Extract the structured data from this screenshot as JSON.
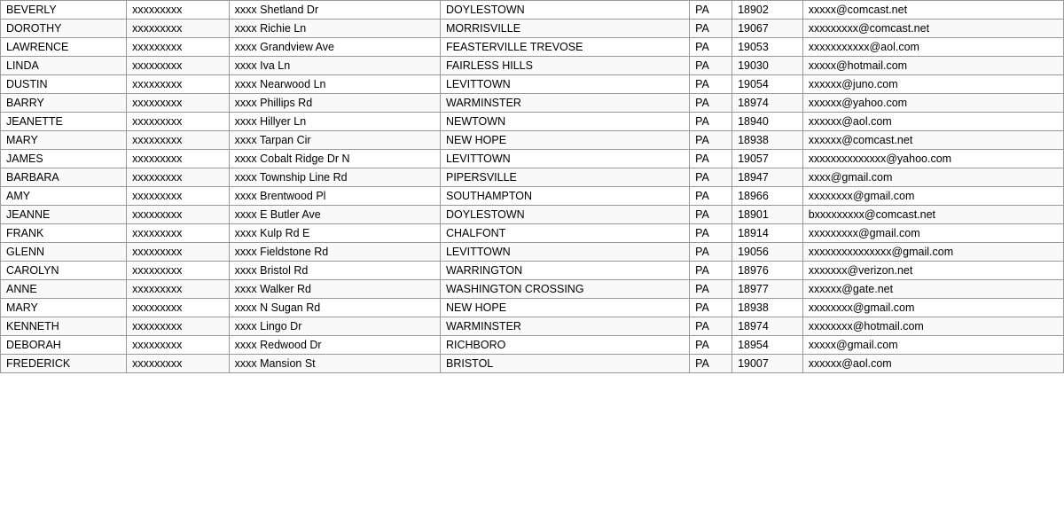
{
  "table": {
    "rows": [
      {
        "first": "BEVERLY",
        "phone": "xxxxxxxxx",
        "address": "xxxx Shetland Dr",
        "city": "DOYLESTOWN",
        "state": "PA",
        "zip": "18902",
        "email": "xxxxx@comcast.net"
      },
      {
        "first": "DOROTHY",
        "phone": "xxxxxxxxx",
        "address": "xxxx Richie Ln",
        "city": "MORRISVILLE",
        "state": "PA",
        "zip": "19067",
        "email": "xxxxxxxxx@comcast.net"
      },
      {
        "first": "LAWRENCE",
        "phone": "xxxxxxxxx",
        "address": "xxxx Grandview Ave",
        "city": "FEASTERVILLE TREVOSE",
        "state": "PA",
        "zip": "19053",
        "email": "xxxxxxxxxxx@aol.com"
      },
      {
        "first": "LINDA",
        "phone": "xxxxxxxxx",
        "address": "xxxx Iva Ln",
        "city": "FAIRLESS HILLS",
        "state": "PA",
        "zip": "19030",
        "email": "xxxxx@hotmail.com"
      },
      {
        "first": "DUSTIN",
        "phone": "xxxxxxxxx",
        "address": "xxxx Nearwood Ln",
        "city": "LEVITTOWN",
        "state": "PA",
        "zip": "19054",
        "email": "xxxxxx@juno.com"
      },
      {
        "first": "BARRY",
        "phone": "xxxxxxxxx",
        "address": "xxxx Phillips Rd",
        "city": "WARMINSTER",
        "state": "PA",
        "zip": "18974",
        "email": "xxxxxx@yahoo.com"
      },
      {
        "first": "JEANETTE",
        "phone": "xxxxxxxxx",
        "address": "xxxx Hillyer Ln",
        "city": "NEWTOWN",
        "state": "PA",
        "zip": "18940",
        "email": "xxxxxx@aol.com"
      },
      {
        "first": "MARY",
        "phone": "xxxxxxxxx",
        "address": "xxxx Tarpan Cir",
        "city": "NEW HOPE",
        "state": "PA",
        "zip": "18938",
        "email": "xxxxxx@comcast.net"
      },
      {
        "first": "JAMES",
        "phone": "xxxxxxxxx",
        "address": "xxxx Cobalt Ridge Dr N",
        "city": "LEVITTOWN",
        "state": "PA",
        "zip": "19057",
        "email": "xxxxxxxxxxxxxx@yahoo.com"
      },
      {
        "first": "BARBARA",
        "phone": "xxxxxxxxx",
        "address": "xxxx Township Line Rd",
        "city": "PIPERSVILLE",
        "state": "PA",
        "zip": "18947",
        "email": "xxxx@gmail.com"
      },
      {
        "first": "AMY",
        "phone": "xxxxxxxxx",
        "address": "xxxx Brentwood Pl",
        "city": "SOUTHAMPTON",
        "state": "PA",
        "zip": "18966",
        "email": "xxxxxxxx@gmail.com"
      },
      {
        "first": "JEANNE",
        "phone": "xxxxxxxxx",
        "address": "xxxx E Butler Ave",
        "city": "DOYLESTOWN",
        "state": "PA",
        "zip": "18901",
        "email": "bxxxxxxxxx@comcast.net"
      },
      {
        "first": "FRANK",
        "phone": "xxxxxxxxx",
        "address": "xxxx Kulp Rd E",
        "city": "CHALFONT",
        "state": "PA",
        "zip": "18914",
        "email": "xxxxxxxxx@gmail.com"
      },
      {
        "first": "GLENN",
        "phone": "xxxxxxxxx",
        "address": "xxxx Fieldstone Rd",
        "city": "LEVITTOWN",
        "state": "PA",
        "zip": "19056",
        "email": "xxxxxxxxxxxxxxx@gmail.com"
      },
      {
        "first": "CAROLYN",
        "phone": "xxxxxxxxx",
        "address": "xxxx Bristol Rd",
        "city": "WARRINGTON",
        "state": "PA",
        "zip": "18976",
        "email": "xxxxxxx@verizon.net"
      },
      {
        "first": "ANNE",
        "phone": "xxxxxxxxx",
        "address": "xxxx Walker Rd",
        "city": "WASHINGTON CROSSING",
        "state": "PA",
        "zip": "18977",
        "email": "xxxxxx@gate.net"
      },
      {
        "first": "MARY",
        "phone": "xxxxxxxxx",
        "address": "xxxx N Sugan Rd",
        "city": "NEW HOPE",
        "state": "PA",
        "zip": "18938",
        "email": "xxxxxxxx@gmail.com"
      },
      {
        "first": "KENNETH",
        "phone": "xxxxxxxxx",
        "address": "xxxx Lingo Dr",
        "city": "WARMINSTER",
        "state": "PA",
        "zip": "18974",
        "email": "xxxxxxxx@hotmail.com"
      },
      {
        "first": "DEBORAH",
        "phone": "xxxxxxxxx",
        "address": "xxxx Redwood Dr",
        "city": "RICHBORO",
        "state": "PA",
        "zip": "18954",
        "email": "xxxxx@gmail.com"
      },
      {
        "first": "FREDERICK",
        "phone": "xxxxxxxxx",
        "address": "xxxx Mansion St",
        "city": "BRISTOL",
        "state": "PA",
        "zip": "19007",
        "email": "xxxxxx@aol.com"
      }
    ]
  }
}
